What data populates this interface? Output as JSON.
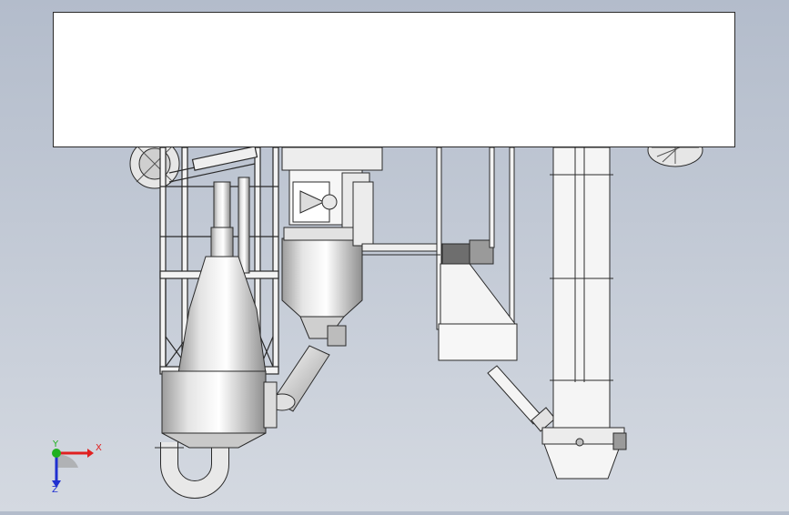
{
  "viewport": {
    "background_top": "#b3bccb",
    "background_bottom": "#d4d9e1",
    "model_fill": "#f1f1f1",
    "model_shade": "#c8c8c8",
    "model_stroke": "#2a2a2a"
  },
  "overlay": {
    "text": ""
  },
  "triad": {
    "x_label": "X",
    "y_label": "Y",
    "z_label": "Z",
    "x_color": "#e02020",
    "y_color": "#20b020",
    "z_color": "#2030d0"
  }
}
